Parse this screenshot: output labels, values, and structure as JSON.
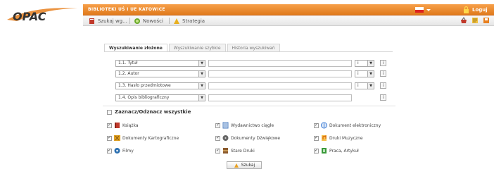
{
  "header": {
    "logo_text": "OPAC",
    "library_name": "BIBLIOTEKI UŚ I UE KATOWICE",
    "login_label": "Loguj"
  },
  "nav": {
    "items": [
      {
        "label": "Szukaj wg...",
        "icon": "search-book-icon"
      },
      {
        "label": "Nowości",
        "icon": "news-icon"
      },
      {
        "label": "Strategia",
        "icon": "strategy-icon"
      }
    ]
  },
  "tabs": [
    {
      "label": "Wyszukiwanie złożone",
      "active": true
    },
    {
      "label": "Wyszukiwanie szybkie",
      "active": false
    },
    {
      "label": "Historia wyszukiwań",
      "active": false
    }
  ],
  "search_rows": [
    {
      "field": "1.1. Tytuł",
      "value": "",
      "operator": "i",
      "info": "i"
    },
    {
      "field": "1.2. Autor",
      "value": "",
      "operator": "i",
      "info": "i"
    },
    {
      "field": "1.3. Hasło przedmiotowe",
      "value": "",
      "operator": "i",
      "info": "i"
    },
    {
      "field": "1.4. Opis bibliograficzny",
      "value": "",
      "operator": "",
      "info": "i"
    }
  ],
  "types": {
    "toggle_all_label": "Zaznacz/Odznacz wszystkie",
    "items": [
      {
        "label": "Książka",
        "icon": "book-icon",
        "color": "#c0392b",
        "checked": true
      },
      {
        "label": "Wydawnictwo ciągłe",
        "icon": "periodical-icon",
        "color": "#4f7fbf",
        "checked": true
      },
      {
        "label": "Dokument elektroniczny",
        "icon": "electronic-document-icon",
        "color": "#3a7bd5",
        "checked": true
      },
      {
        "label": "Dokumenty Kartograficzne",
        "icon": "map-icon",
        "color": "#e0a020",
        "checked": true
      },
      {
        "label": "Dokumenty Dźwiękowe",
        "icon": "sound-icon",
        "color": "#666666",
        "checked": true
      },
      {
        "label": "Druki Muzyczne",
        "icon": "music-icon",
        "color": "#d35400",
        "checked": true
      },
      {
        "label": "Filmy",
        "icon": "film-icon",
        "color": "#2a6fb0",
        "checked": true
      },
      {
        "label": "Stare Druki",
        "icon": "old-print-icon",
        "color": "#8b5a2b",
        "checked": true
      },
      {
        "label": "Praca, Artykuł",
        "icon": "article-icon",
        "color": "#3a9a3a",
        "checked": true
      }
    ]
  },
  "search_button": {
    "label": "Szukaj"
  },
  "colors": {
    "accent": "#e8801f"
  }
}
